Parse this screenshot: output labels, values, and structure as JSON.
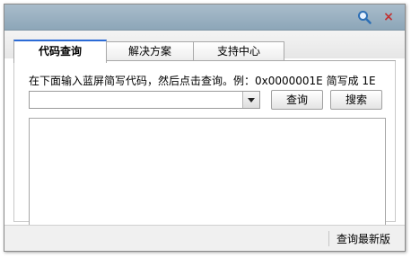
{
  "window": {
    "title": ""
  },
  "titlebar": {
    "search_icon": "search-icon",
    "close_icon": "close-icon",
    "close_glyph": "×"
  },
  "tabs": [
    {
      "label": "代码查询",
      "active": true
    },
    {
      "label": "解决方案",
      "active": false
    },
    {
      "label": "支持中心",
      "active": false
    }
  ],
  "main": {
    "hint": "在下面输入蓝屏简写代码，然后点击查询。例：0x0000001E 简写成 1E",
    "combo_value": "",
    "query_button": "查询",
    "search_button": "搜索",
    "result_text": ""
  },
  "statusbar": {
    "latest_version_link": "查询最新版"
  },
  "colors": {
    "titlebar": "#9bb0c1",
    "active_tab_border": "#2b6bd6",
    "close": "#c23030"
  }
}
